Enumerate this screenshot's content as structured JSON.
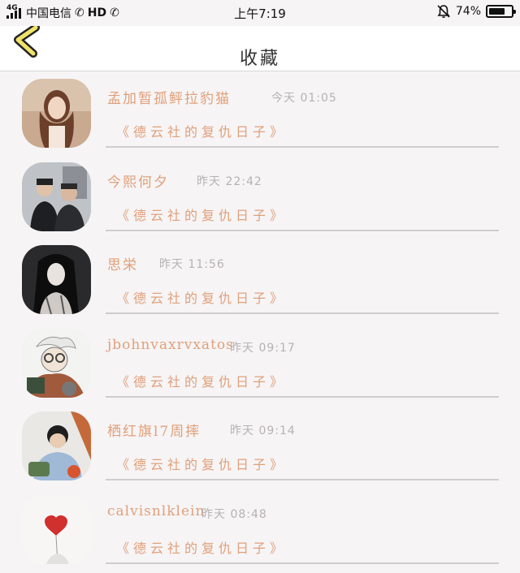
{
  "status_bar": {
    "network": "4G",
    "carrier": "中国电信",
    "hd": "HD",
    "time": "上午7:19",
    "battery_text": "74%",
    "battery_level": 0.74
  },
  "nav": {
    "title": "收藏"
  },
  "items": [
    {
      "name": "孟加暂孤鲆拉豹猫",
      "time": "今天 01:05",
      "title": "《德云社的复仇日子》"
    },
    {
      "name": "今熙何夕",
      "time": "昨天 22:42",
      "title": "《德云社的复仇日子》"
    },
    {
      "name": "思栄",
      "time": "昨天 11:56",
      "title": "《德云社的复仇日子》"
    },
    {
      "name": "jbohnvaxrvxatos",
      "time": "昨天 09:17",
      "title": "《德云社的复仇日子》"
    },
    {
      "name": "栖红旗l7周摔",
      "time": "昨天 09:14",
      "title": "《德云社的复仇日子》"
    },
    {
      "name": "calvisnlklein",
      "time": "昨天 08:48",
      "title": "《德云社的复仇日子》"
    }
  ]
}
